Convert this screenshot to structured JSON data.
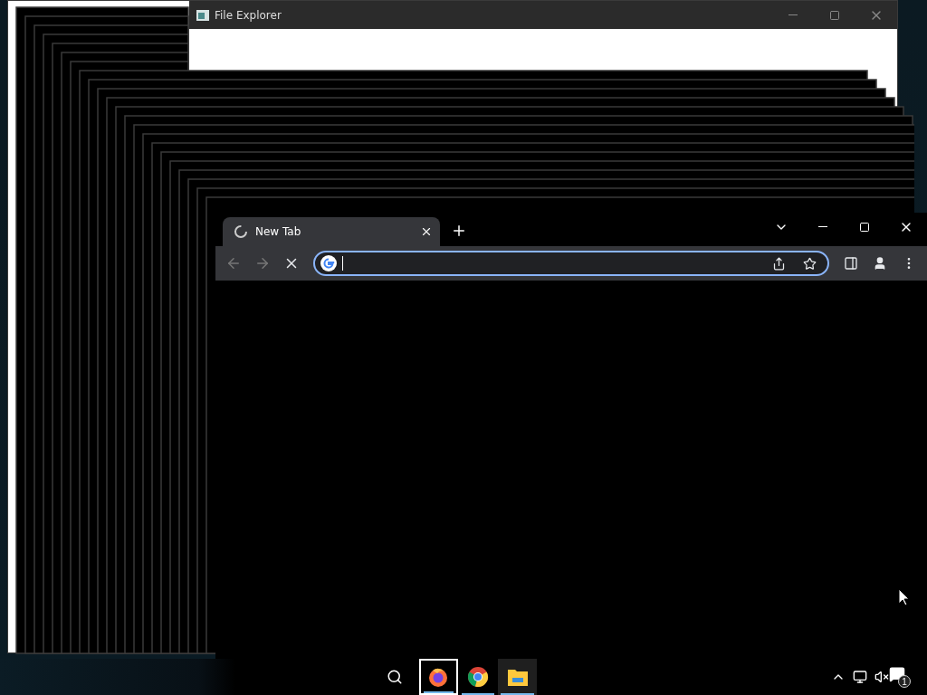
{
  "file_explorer": {
    "title": "File Explorer"
  },
  "browser": {
    "tabs": [
      {
        "title": "New Tab",
        "selected": true
      }
    ],
    "loading": true
  },
  "taskbar": {
    "apps": [
      {
        "kind": "firefox",
        "selected": true
      },
      {
        "kind": "chrome",
        "selected": false
      },
      {
        "kind": "explorer",
        "selected": false
      }
    ],
    "muted": true,
    "notification_count": "1"
  }
}
